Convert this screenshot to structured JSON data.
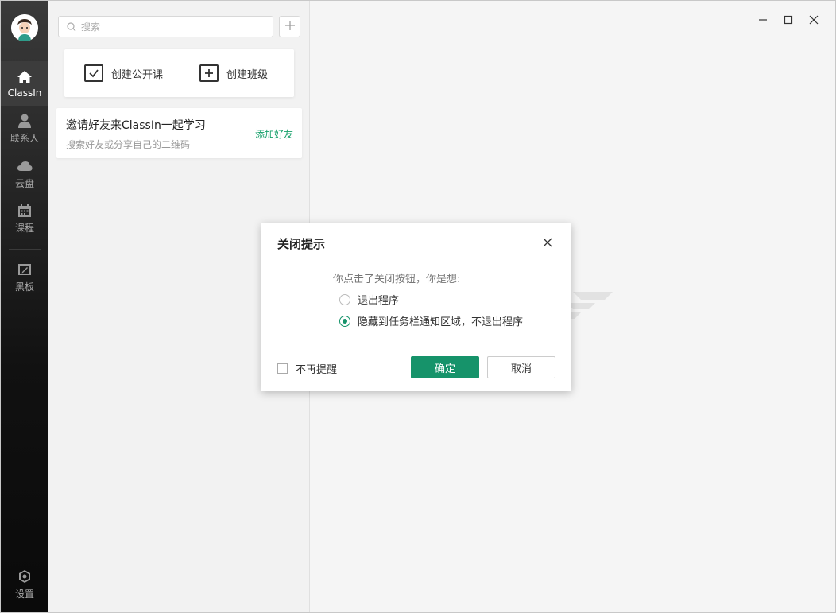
{
  "nav": {
    "items": [
      {
        "label": "ClassIn",
        "icon": "home-icon",
        "active": true
      },
      {
        "label": "联系人",
        "icon": "person-icon",
        "active": false
      },
      {
        "label": "云盘",
        "icon": "cloud-icon",
        "active": false
      },
      {
        "label": "课程",
        "icon": "calendar-icon",
        "active": false
      },
      {
        "label": "黑板",
        "icon": "blackboard-icon",
        "active": false
      }
    ],
    "settings_label": "设置"
  },
  "panel": {
    "search_placeholder": "搜索",
    "create_lesson_label": "创建公开课",
    "create_class_label": "创建班级",
    "invite_title": "邀请好友来ClassIn一起学习",
    "invite_sub": "搜索好友或分享自己的二维码",
    "invite_link": "添加好友"
  },
  "dialog": {
    "title": "关闭提示",
    "question": "你点击了关闭按钮，你是想:",
    "options": [
      {
        "label": "退出程序",
        "checked": false
      },
      {
        "label": "隐藏到任务栏通知区域，不退出程序",
        "checked": true
      }
    ],
    "dont_remind_label": "不再提醒",
    "ok_label": "确定",
    "cancel_label": "取消"
  },
  "colors": {
    "accent": "#16936a",
    "link": "#16a06a",
    "nav_bg": "#1a1a1a"
  }
}
